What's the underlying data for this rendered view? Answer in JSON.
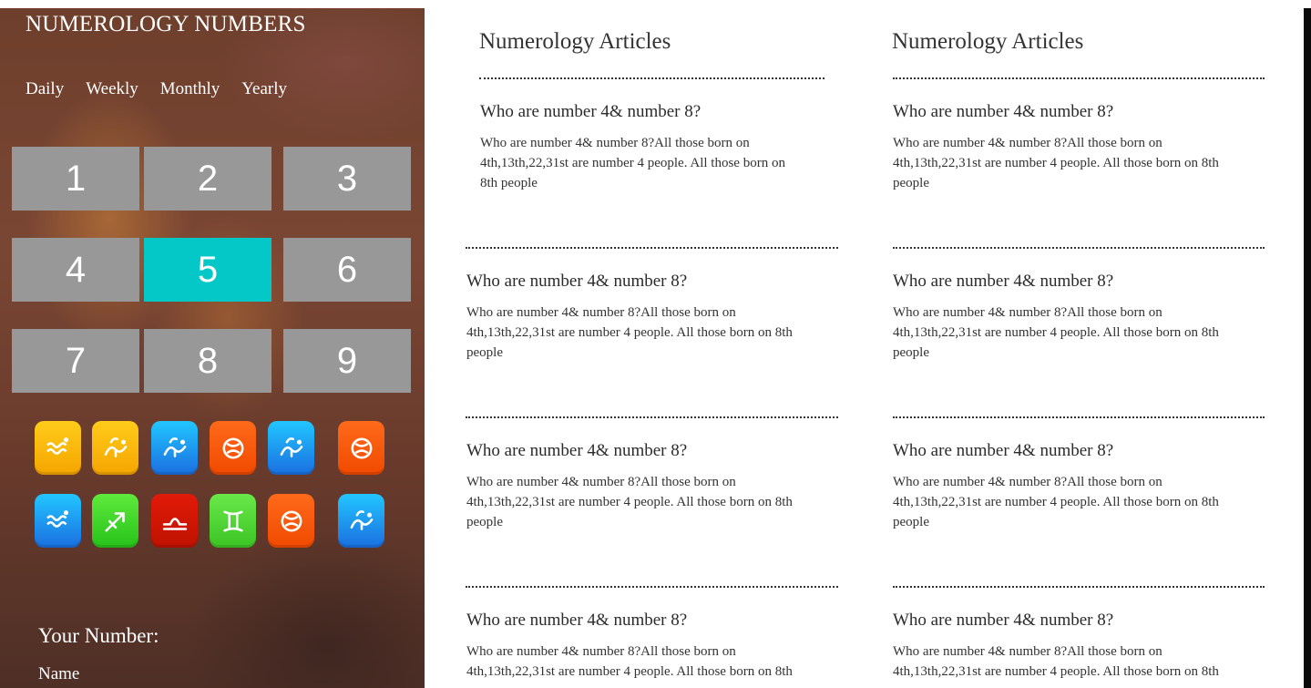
{
  "site": {
    "title": "NUMEROLOGY NUMBERS"
  },
  "nav": {
    "periods": [
      {
        "label": "Daily"
      },
      {
        "label": "Weekly"
      },
      {
        "label": "Monthly"
      },
      {
        "label": "Yearly"
      }
    ]
  },
  "numbers": [
    {
      "label": "1"
    },
    {
      "label": "2"
    },
    {
      "label": "3"
    },
    {
      "label": "4"
    },
    {
      "label": "5",
      "selected": true
    },
    {
      "label": "6"
    },
    {
      "label": "7"
    },
    {
      "label": "8"
    },
    {
      "label": "9"
    }
  ],
  "zodiac_icons": [
    {
      "sign": "aquarius-icon",
      "color": "#f8b400"
    },
    {
      "sign": "capricorn-icon",
      "color": "#f8b400"
    },
    {
      "sign": "capricorn-icon",
      "color": "#1a8cf0"
    },
    {
      "sign": "pisces-icon",
      "color": "#f45a0a"
    },
    {
      "sign": "capricorn-icon",
      "color": "#1a8cf0"
    },
    {
      "sign": "pisces-icon",
      "color": "#f45a0a"
    },
    {
      "sign": "aquarius-icon",
      "color": "#1a8cf0"
    },
    {
      "sign": "sagittarius-icon",
      "color": "#2ed21e"
    },
    {
      "sign": "libra-icon",
      "color": "#d01605"
    },
    {
      "sign": "gemini-icon",
      "color": "#4ad830"
    },
    {
      "sign": "pisces-icon",
      "color": "#f45a0a"
    },
    {
      "sign": "capricorn-icon",
      "color": "#1a8cf0"
    }
  ],
  "your_number": {
    "title": "Your Number:",
    "name_label": "Name"
  },
  "articles": {
    "left": {
      "heading": "Numerology Articles",
      "items": [
        {
          "title": "Who are number 4& number 8?",
          "lines": [
            "Who are number 4& number 8?All those born on",
            "4th,13th,22,31st are number 4 people. All those born on",
            "8th people"
          ]
        },
        {
          "title": "Who are number 4& number 8?",
          "lines": [
            "Who are number 4& number 8?All those born on",
            "4th,13th,22,31st are number 4 people. All those born on 8th",
            "people"
          ]
        },
        {
          "title": "Who are number 4& number 8?",
          "lines": [
            "Who are number 4& number 8?All those born on",
            "4th,13th,22,31st are number 4 people. All those born on 8th",
            "people"
          ]
        },
        {
          "title": "Who are number 4& number 8?",
          "lines": [
            "Who are number 4& number 8?All those born on",
            "4th,13th,22,31st are number 4 people. All those born on 8th"
          ]
        }
      ]
    },
    "right": {
      "heading": "Numerology Articles",
      "items": [
        {
          "title": "Who are number 4& number 8?",
          "lines": [
            "Who are number 4& number 8?All those born on",
            "4th,13th,22,31st are number 4 people. All those born on 8th",
            "people"
          ]
        },
        {
          "title": "Who are number 4& number 8?",
          "lines": [
            "Who are number 4& number 8?All those born on",
            "4th,13th,22,31st are number 4 people. All those born on 8th",
            "people"
          ]
        },
        {
          "title": "Who are number 4& number 8?",
          "lines": [
            "Who are number 4& number 8?All those born on",
            "4th,13th,22,31st are number 4 people. All those born on 8th",
            "people"
          ]
        },
        {
          "title": "Who are number 4& number 8?",
          "lines": [
            "Who are number 4& number 8?All those born on",
            "4th,13th,22,31st are number 4 people. All those born on 8th"
          ]
        }
      ]
    }
  }
}
